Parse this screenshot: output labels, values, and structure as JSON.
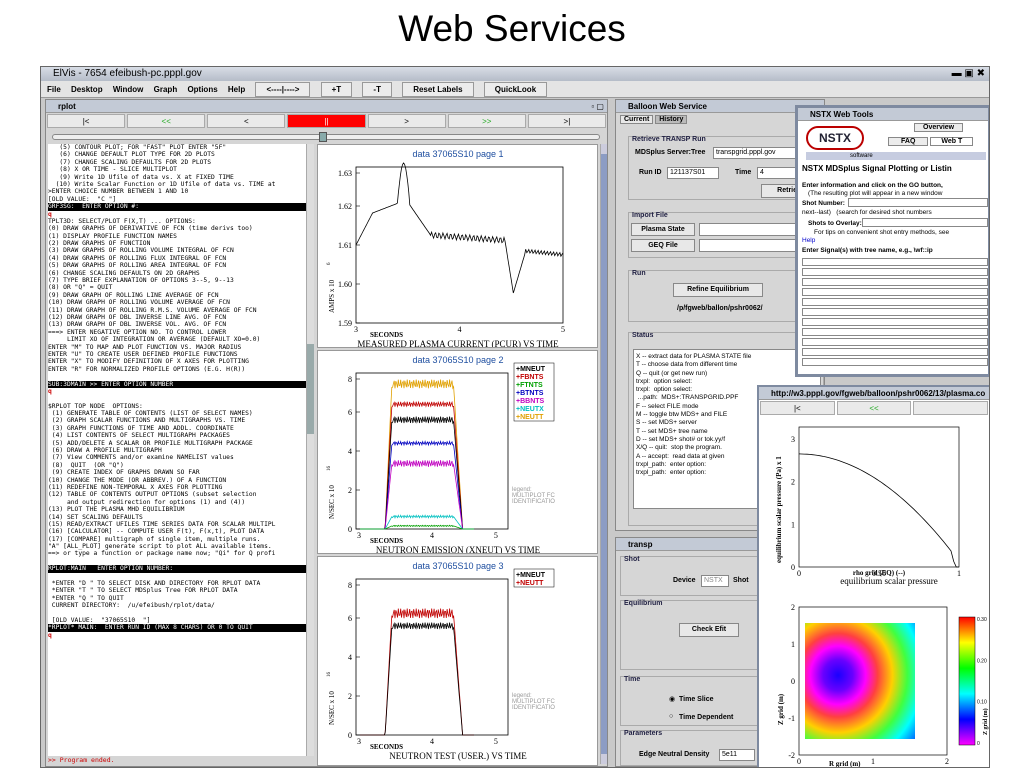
{
  "slide_title": "Web Services",
  "elvis": {
    "title": "ElVis - 7654 efeibush-pc.pppl.gov",
    "menu": [
      "File",
      "Desktop",
      "Window",
      "Graph",
      "Options",
      "Help"
    ],
    "toolbar": [
      "<----|---->",
      "+T",
      "-T",
      "Reset Labels",
      "QuickLook"
    ]
  },
  "rplot": {
    "title": "rplot",
    "nav": [
      "|<",
      "<<",
      "<",
      "||",
      ">",
      ">>",
      ">|"
    ],
    "terminal_lines": [
      "   (5) CONTOUR PLOT; FOR \"FAST\" PLOT ENTER \"5F\"",
      "   (6) CHANGE DEFAULT PLOT TYPE FOR 2D PLOTS",
      "   (7) CHANGE SCALING DEFAULTS FOR 2D PLOTS",
      "   (8) X OR TIME - SLICE MULTIPLOT",
      "   (9) Write 1D Ufile of data vs. X at FIXED TIME",
      "  (10) Write Scalar Function or 1D Ufile of data vs. TIME at",
      ">ENTER CHOICE NUMBER BETWEEN 1 AND 10",
      "[OLD VALUE:  \"C \"]",
      "GRF3SG:  ENTER OPTION #:",
      "q",
      "TPLT3D: SELECT/PLOT F(X,T) ... OPTIONS:",
      "(0) DRAW GRAPHS OF DERIVATIVE OF FCN (time derivs too)",
      "(1) DISPLAY PROFILE FUNCTION NAMES",
      "(2) DRAW GRAPHS OF FUNCTION",
      "(3) DRAW GRAPHS OF ROLLING VOLUME INTEGRAL OF FCN",
      "(4) DRAW GRAPHS OF ROLLING FLUX INTEGRAL OF FCN",
      "(5) DRAW GRAPHS OF ROLLING AREA INTEGRAL OF FCN",
      "(6) CHANGE SCALING DEFAULTS ON 2D GRAPHS",
      "(7) TYPE BRIEF EXPLANATION OF OPTIONS 3--5, 9--13",
      "(8) OR \"Q\" = QUIT",
      "(9) DRAW GRAPH OF ROLLING LINE AVERAGE OF FCN",
      "(10) DRAW GRAPH OF ROLLING VOLUME AVERAGE OF FCN",
      "(11) DRAW GRAPH OF ROLLING R.M.S. VOLUME AVERAGE OF FCN",
      "(12) DRAW GRAPH OF DBL INVERSE LINE AVG. OF FCN",
      "(13) DRAW GRAPH OF DBL INVERSE VOL. AVG. OF FCN",
      "===> ENTER NEGATIVE OPTION NO. TO CONTROL LOWER",
      "     LIMIT XO OF INTEGRATION OR AVERAGE (DEFAULT XO=0.0)",
      "ENTER \"M\" TO MAP AND PLOT FUNCTION VS. MAJOR RADIUS",
      "ENTER \"U\" TO CREATE USER DEFINED PROFILE FUNCTIONS",
      "ENTER \"X\" TO MODIFY DEFINITION OF X AXES FOR PLOTTING",
      "ENTER \"R\" FOR NORMALIZED PROFILE OPTIONS (E.G. H(R))",
      "",
      "SUB:3DMAIN >> ENTER OPTION NUMBER",
      "q",
      "",
      "$RPLOT TOP NODE  OPTIONS:",
      " (1) GENERATE TABLE OF CONTENTS (LIST OF SELECT NAMES)",
      " (2) GRAPH SCALAR FUNCTIONS AND MULTIGRAPHS VS. TIME",
      " (3) GRAPH FUNCTIONS OF TIME AND ADDL. COORDINATE",
      " (4) LIST CONTENTS OF SELECT MULTIGRAPH PACKAGES",
      " (5) ADD/DELETE A SCALAR OR PROFILE MULTIGRAPH PACKAGE",
      " (6) DRAW A PROFILE MULTIGRAPH",
      " (7) View COMMENTS and/or examine NAMELIST values",
      " (8)  QUIT  (OR \"Q\")",
      " (9) CREATE INDEX OF GRAPHS DRAWN SO FAR",
      "(10) CHANGE THE MODE (OR ABBREV.) OF A FUNCTION",
      "(11) REDEFINE NON-TEMPORAL X AXES FOR PLOTTING",
      "(12) TABLE OF CONTENTS OUTPUT OPTIONS (subset selection",
      "     and output redirection for options (1) and (4))",
      "(13) PLOT THE PLASMA MHD EQUILIBRIUM",
      "(14) SET SCALING DEFAULTS",
      "(15) READ/EXTRACT UFILES TIME SERIES DATA FOR SCALAR MULTIPL",
      "(16) [CALCULATOR] -- COMPUTE USER F(t), F(x,t), PLOT DATA",
      "(17) [COMPARE] multigraph of single item, multiple runs.",
      "\"A\" [ALL_PLOT] generate script to plot ALL available items.",
      "==> or type a function or package name now; \"Qi\" for Q profi",
      "",
      "RPLOT:MAIN   ENTER OPTION NUMBER:",
      "",
      " *ENTER \"D \" TO SELECT DISK AND DIRECTORY FOR RPLOT DATA",
      " *ENTER \"T \" TO SELECT MDSplus Tree FOR RPLOT DATA",
      " *ENTER \"Q \" TO QUIT",
      " CURRENT DIRECTORY:  /u/efeibush/rplot/data/",
      "",
      " [OLD VALUE:  \"37065S10  \"]",
      "*RPLOT* MAIN:  ENTER RUN ID (MAX 8 CHARS) OR 0 TO QUIT",
      "q"
    ],
    "status_line": ">> Program ended.",
    "plots": [
      {
        "header": "data 37065S10 page 1",
        "xlabel": "SECONDS",
        "title": "MEASURED PLASMA CURRENT (PCUR) VS TIME",
        "ylabel": "AMPS x 10",
        "yexp": "6",
        "yticks": [
          "1.63",
          "1.62",
          "1.61",
          "1.60",
          "1.59"
        ],
        "xticks": [
          "3",
          "4",
          "5"
        ]
      },
      {
        "header": "data 37065S10 page 2",
        "xlabel": "SECONDS",
        "title": "NEUTRON EMISSION (XNEUT) VS TIME",
        "ylabel": "N/SEC x 10",
        "yexp": "16",
        "yticks": [
          "8",
          "6",
          "4",
          "2",
          "0"
        ],
        "xticks": [
          "3",
          "4",
          "5"
        ],
        "legend": [
          "+MNEUT",
          "+FBNTS",
          "+FTNTS",
          "+BTNTS",
          "+BBNTS",
          "+NEUTX",
          "+NEUTT"
        ],
        "legend_colors": [
          "#000000",
          "#c00000",
          "#00a000",
          "#0000c0",
          "#c000c0",
          "#00c0c0",
          "#e0a000"
        ],
        "watermark": [
          "legend:",
          "MULTIPLOT FC",
          "IDENTIFICATIO"
        ]
      },
      {
        "header": "data 37065S10 page 3",
        "xlabel": "SECONDS",
        "title": "NEUTRON TEST (USER.) VS TIME",
        "ylabel": "N/SEC x 10",
        "yexp": "16",
        "yticks": [
          "8",
          "6",
          "4",
          "2",
          "0"
        ],
        "xticks": [
          "3",
          "4",
          "5"
        ],
        "legend": [
          "+MNEUT",
          "+NEUTT"
        ],
        "legend_colors": [
          "#000000",
          "#c00000"
        ],
        "watermark": [
          "legend:",
          "MULTIPLOT FC",
          "IDENTIFICATIO"
        ]
      }
    ]
  },
  "balloon": {
    "title": "Balloon Web Service",
    "tabs": [
      "Current",
      "History"
    ],
    "retrieve_group": "Retrieve TRANSP Run",
    "mdsplus_label": "MDSplus Server:Tree",
    "mdsplus_value": "transpgrid.pppl.gov",
    "runid_label": "Run ID",
    "runid_value": "121137S01",
    "time_label": "Time",
    "time_value": "4",
    "retrieve_btn": "Retrieve",
    "import_group": "Import File",
    "plasma_state_btn": "Plasma State",
    "geq_btn": "GEQ File",
    "run_group": "Run",
    "refine_btn": "Refine Equilibrium",
    "run_path": "/p/fgweb/ballon/pshr0062/",
    "status_group": "Status",
    "status_lines": [
      "X -- extract data for PLASMA STATE file",
      "T -- choose data from different time",
      "Q -- quit (or get new run)",
      "trxpl:  option select:",
      "trxpl:  option select:",
      "",
      " ...path:  MDS+:TRANSPGRID.PPF",
      "",
      "F -- select FILE mode",
      "M -- toggle btw MDS+ and FILE",
      "S -- set MDS+ server",
      "T -- set MDS+ tree name",
      "D -- set MDS+ shot# or tok.yy/f",
      "X/Q -- quit:  stop the program.",
      "A -- accept:  read data at given",
      "trxpl_path:  enter option:",
      "trxpl_path:  enter option:"
    ]
  },
  "transp": {
    "title": "transp",
    "shot_group": "Shot",
    "device_label": "Device",
    "device_value": "NSTX",
    "shot_label": "Shot",
    "equilibrium_group": "Equilibrium",
    "check_efit_btn": "Check Efit",
    "time_group": "Time",
    "time_slice": "Time Slice",
    "time_dependent": "Time Dependent",
    "params_group": "Parameters",
    "edge_label": "Edge Neutral Density",
    "edge_value": "5e11"
  },
  "nstx": {
    "title": "NSTX Web Tools",
    "logo": "NSTX",
    "tabs": [
      "Overview",
      "FAQ",
      "Web T"
    ],
    "software": "software",
    "heading": "NSTX MDSplus Signal Plotting or Listin",
    "instr1": "Enter information and click on the GO button,",
    "instr2": "(The resulting plot will appear in a new window",
    "shot_label": "Shot Number:",
    "next_last": "next--last)   (search for desired shot numbers",
    "overlay_label": "Shots to Overlay:",
    "tips": "For tips on convenient shot entry methods, see",
    "help": "Help",
    "signal_label": "Enter Signal(s) with tree name, e.g., \\wf::ip"
  },
  "ballon_plot": {
    "title": "http://w3.pppl.gov/fgweb/balloon/pshr0062/13/plasma.co",
    "nav": [
      "|<",
      "<<",
      ""
    ],
    "top_ylabel": "equilibrium scalar pressure (Pa) x 1",
    "top_yticks": [
      "3",
      "2",
      "1",
      "0"
    ],
    "top_xticks": [
      "0",
      "0.50",
      "1"
    ],
    "top_xlabel": "rho grid (EQ) (--)",
    "top_title": "equilibrium scalar pressure",
    "bot_ylabel": "Z grid (m)",
    "bot_yticks": [
      "2",
      "1",
      "0",
      "-1",
      "-2"
    ],
    "bot_xticks": [
      "0",
      "1",
      "2"
    ],
    "bot_xlabel": "R grid (m)",
    "bot_title": "Psi(R,Z)",
    "cbar_ticks": [
      "0.30",
      "0.20",
      "0.10",
      "0"
    ],
    "cbar_label": "Z grid (m)",
    "accent": "#1f4fa0"
  }
}
